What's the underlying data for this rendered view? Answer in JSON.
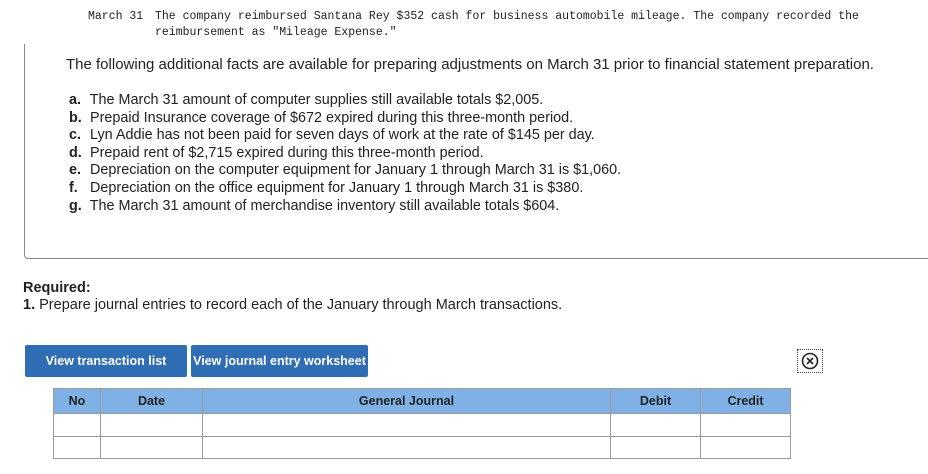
{
  "transaction": {
    "date": "March 31",
    "line1": "The company reimbursed Santana Rey $352 cash for business automobile mileage. The company recorded the",
    "line2": "reimbursement as \"Mileage Expense.\""
  },
  "facts_intro": "The following additional facts are available for preparing adjustments on March 31 prior to financial statement preparation.",
  "facts": [
    {
      "letter": "a.",
      "text": "The March 31 amount of computer supplies still available totals $2,005."
    },
    {
      "letter": "b.",
      "text": "Prepaid Insurance coverage of $672 expired during this three-month period."
    },
    {
      "letter": "c.",
      "text": "Lyn Addie has not been paid for seven days of work at the rate of $145 per day."
    },
    {
      "letter": "d.",
      "text": "Prepaid rent of $2,715 expired during this three-month period."
    },
    {
      "letter": "e.",
      "text": "Depreciation on the computer equipment for January 1 through March 31 is $1,060."
    },
    {
      "letter": "f.",
      "text": "Depreciation on the office equipment for January 1 through March 31 is $380."
    },
    {
      "letter": "g.",
      "text": "The March 31 amount of merchandise inventory still available totals $604."
    }
  ],
  "required": {
    "heading": "Required:",
    "item_number": "1.",
    "item_text": "Prepare journal entries to record each of the January through March transactions."
  },
  "buttons": {
    "view_transaction_list": "View transaction list",
    "view_journal_entry_worksheet": "View journal entry worksheet"
  },
  "close_icon": "circle-x-icon",
  "journal": {
    "columns": [
      "No",
      "Date",
      "General Journal",
      "Debit",
      "Credit"
    ],
    "rows": [
      [
        "",
        "",
        "",
        "",
        ""
      ],
      [
        "",
        "",
        "",
        "",
        ""
      ]
    ]
  },
  "colors": {
    "button_bg": "#2f6db5",
    "table_header_bg": "#7fb1e6"
  }
}
